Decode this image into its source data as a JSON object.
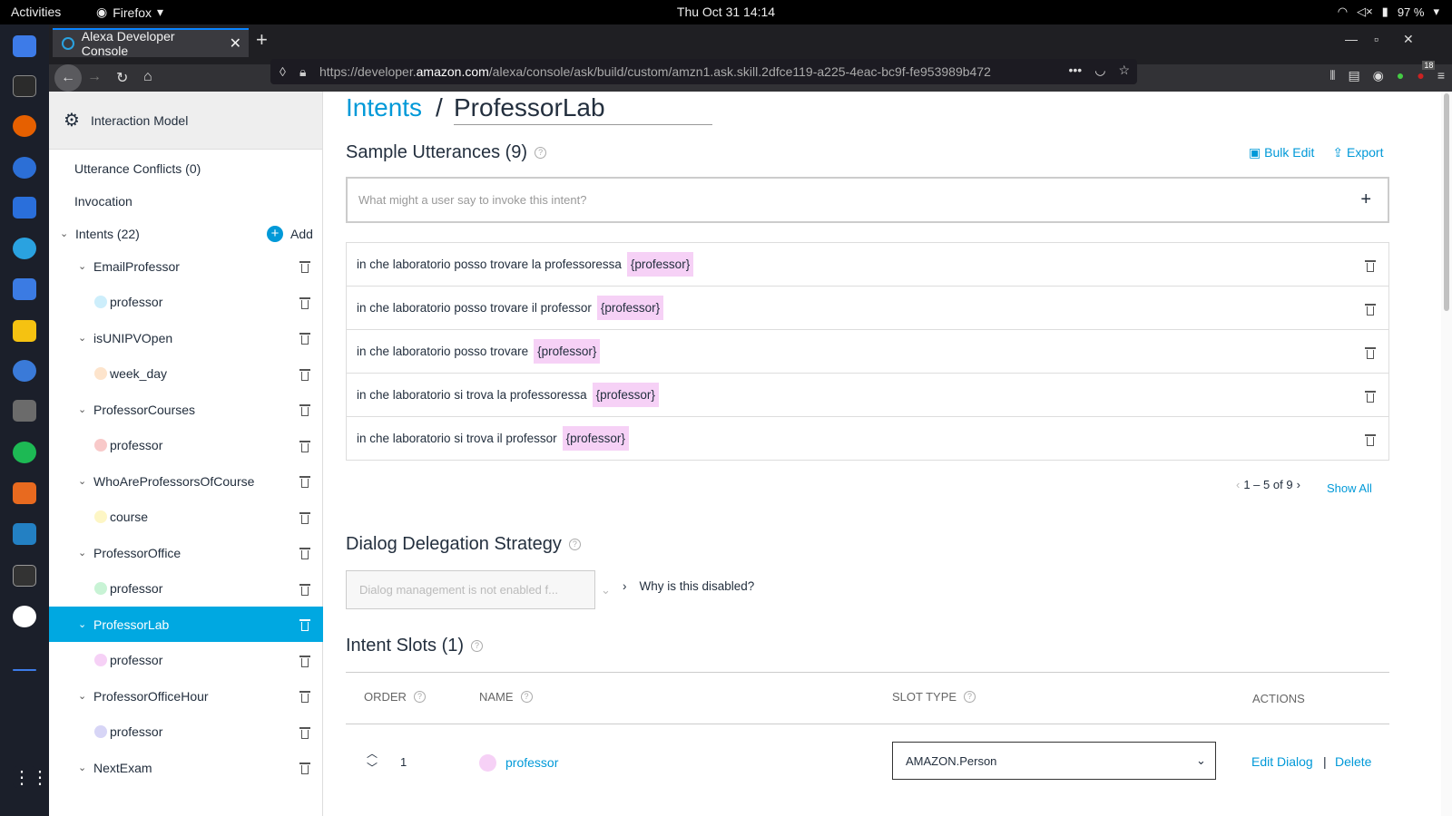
{
  "system": {
    "activities": "Activities",
    "app": "Firefox",
    "clock": "Thu Oct 31  14:14",
    "battery": "97 %"
  },
  "browser": {
    "tab_title": "Alexa Developer Console",
    "url_pre": "https://developer.",
    "url_host": "amazon.com",
    "url_post": "/alexa/console/ask/build/custom/amzn1.ask.skill.2dfce119-a225-4eac-bc9f-fe953989b472",
    "ext_badge": "18"
  },
  "sidebar": {
    "model": "Interaction Model",
    "conflicts": "Utterance Conflicts (0)",
    "invocation": "Invocation",
    "intents": "Intents (22)",
    "add": "Add",
    "items": [
      {
        "label": "EmailProfessor",
        "kind": "intent"
      },
      {
        "label": "professor",
        "kind": "slot",
        "color": "#cdeefb"
      },
      {
        "label": "isUNIPVOpen",
        "kind": "intent"
      },
      {
        "label": "week_day",
        "kind": "slot",
        "color": "#fde4cc"
      },
      {
        "label": "ProfessorCourses",
        "kind": "intent"
      },
      {
        "label": "professor",
        "kind": "slot",
        "color": "#f8c9c9"
      },
      {
        "label": "WhoAreProfessorsOfCourse",
        "kind": "intent"
      },
      {
        "label": "course",
        "kind": "slot",
        "color": "#fdf6c5"
      },
      {
        "label": "ProfessorOffice",
        "kind": "intent"
      },
      {
        "label": "professor",
        "kind": "slot",
        "color": "#c8f3d5"
      },
      {
        "label": "ProfessorLab",
        "kind": "intent",
        "selected": true
      },
      {
        "label": "professor",
        "kind": "slot",
        "color": "#f6d1f6"
      },
      {
        "label": "ProfessorOfficeHour",
        "kind": "intent"
      },
      {
        "label": "professor",
        "kind": "slot",
        "color": "#d7d5f6"
      },
      {
        "label": "NextExam",
        "kind": "intent"
      }
    ]
  },
  "main": {
    "crumb": "Intents",
    "sep": "/",
    "title": "ProfessorLab",
    "utt_title": "Sample Utterances (9)",
    "bulk": "Bulk Edit",
    "export": "Export",
    "placeholder": "What might a user say to invoke this intent?",
    "utterances": [
      {
        "text": "in che laboratorio posso trovare la professoressa",
        "slot": "{professor}"
      },
      {
        "text": "in che laboratorio posso trovare il professor",
        "slot": "{professor}"
      },
      {
        "text": "in che laboratorio posso trovare",
        "slot": "{professor}"
      },
      {
        "text": "in che laboratorio si trova la professoressa",
        "slot": "{professor}"
      },
      {
        "text": "in che laboratorio si trova il professor",
        "slot": "{professor}"
      }
    ],
    "pager": "1 – 5 of 9",
    "show_all": "Show All",
    "dialog_title": "Dialog Delegation Strategy",
    "dialog_value": "Dialog management is not enabled f...",
    "why": "Why is this disabled?",
    "slots_title": "Intent Slots (1)",
    "cols": {
      "order": "ORDER",
      "name": "NAME",
      "type": "SLOT TYPE",
      "actions": "ACTIONS"
    },
    "slot_row": {
      "order": "1",
      "name": "professor",
      "type": "AMAZON.Person",
      "edit": "Edit Dialog",
      "pipe": "|",
      "delete": "Delete",
      "color": "#f6d1f6"
    }
  }
}
